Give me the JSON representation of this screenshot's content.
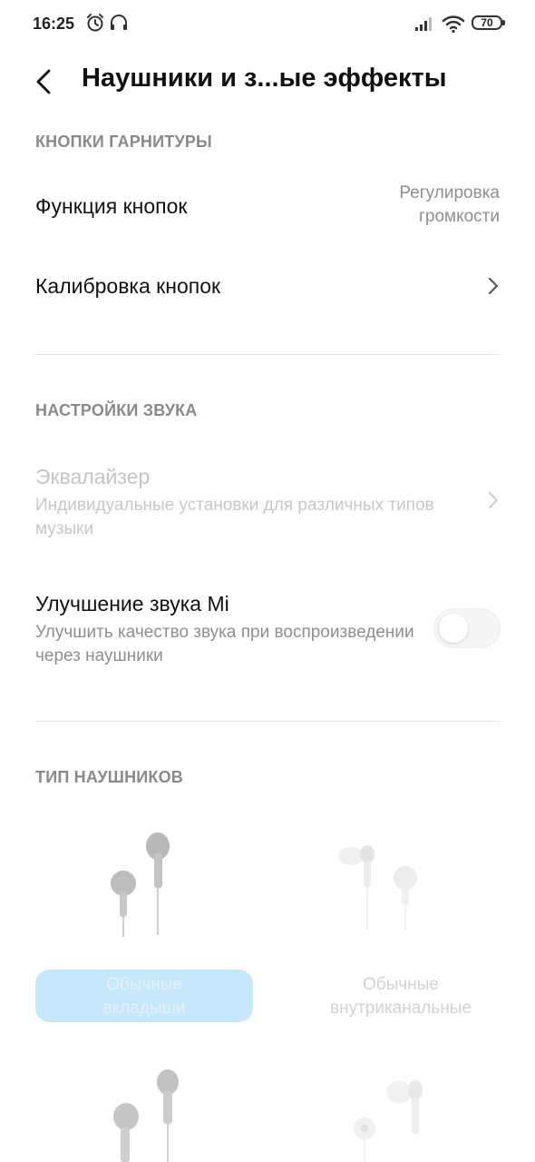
{
  "status_bar": {
    "time": "16:25",
    "battery": "70",
    "icons": [
      "alarm-icon",
      "headset-icon",
      "signal-icon",
      "wifi-icon",
      "battery-icon"
    ]
  },
  "header": {
    "title": "Наушники и з...ые эффекты",
    "back_icon": "chevron-left-icon"
  },
  "sections": {
    "headset_buttons": {
      "title": "КНОПКИ ГАРНИТУРЫ",
      "button_function": {
        "title": "Функция кнопок",
        "value_line1": "Регулировка",
        "value_line2": "громкости"
      },
      "button_calibration": {
        "title": "Калибровка кнопок"
      }
    },
    "sound_settings": {
      "title": "НАСТРОЙКИ ЗВУКА",
      "equalizer": {
        "title": "Эквалайзер",
        "subtitle": "Индивидуальные установки для различных типов музыки"
      },
      "mi_sound": {
        "title": "Улучшение звука Mi",
        "subtitle": "Улучшить качество звука при воспроизведении через наушники",
        "enabled": false
      }
    },
    "headphone_type": {
      "title": "ТИП НАУШНИКОВ",
      "options": [
        {
          "line1": "Обычные",
          "line2": "вкладыши",
          "selected": true
        },
        {
          "line1": "Обычные",
          "line2": "внутриканальные",
          "selected": false
        }
      ]
    }
  },
  "colors": {
    "accent_selected": "#c7e7fb",
    "section_title": "#8a8a8a",
    "secondary_text": "#8f8f8f"
  }
}
